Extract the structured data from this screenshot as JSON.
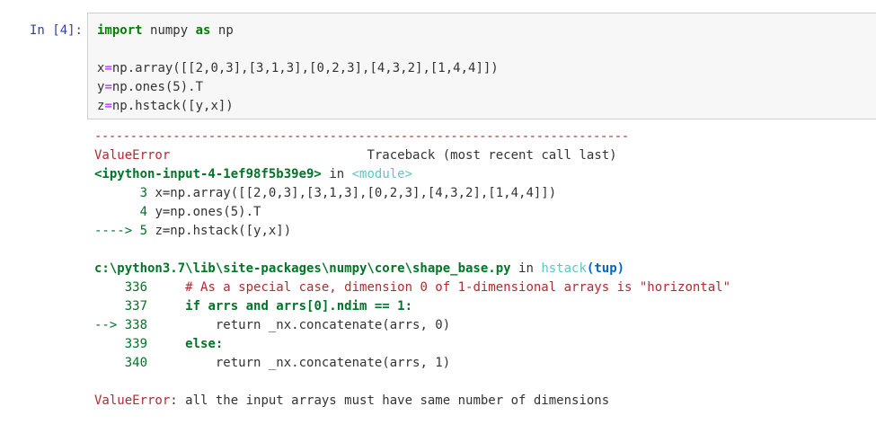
{
  "cell": {
    "prompt": "In [4]:",
    "code": {
      "kw_import": "import",
      "mod": "numpy",
      "kw_as": "as",
      "alias": "np",
      "line2_var": "x",
      "line2_rest": "np.array([[2,0,3],[3,1,3],[0,2,3],[4,3,2],[1,4,4]])",
      "line3_var": "y",
      "line3_rest": "np.ones(5).T",
      "line4_var": "z",
      "line4_rest": "np.hstack([y,x])"
    }
  },
  "output": {
    "separator": "---------------------------------------------------------------------------",
    "error_name": "ValueError",
    "traceback_header": "Traceback (most recent call last)",
    "frame1": {
      "input_name": "<ipython-input-4-1ef98f5b39e9>",
      "in_word": "in",
      "module": "<module>",
      "lines": [
        {
          "prefix": "      3 ",
          "code": "x=np.array([[2,0,3],[3,1,3],[0,2,3],[4,3,2],[1,4,4]])"
        },
        {
          "prefix": "      4 ",
          "code": "y=np.ones(5).T"
        },
        {
          "prefix": "----> 5 ",
          "code": "z=np.hstack([y,x])"
        }
      ]
    },
    "frame2": {
      "path": "c:\\python3.7\\lib\\site-packages\\numpy\\core\\shape_base.py",
      "in_word": "in",
      "func": "hstack",
      "args": "(tup)",
      "lines": [
        {
          "prefix": "    336 ",
          "code": "    # As a special case, dimension 0 of 1-dimensional arrays is \"horizontal\""
        },
        {
          "prefix": "    337 ",
          "code": "    if arrs and arrs[0].ndim == 1:"
        },
        {
          "prefix": "--> 338 ",
          "code": "        return _nx.concatenate(arrs, 0)"
        },
        {
          "prefix": "    339 ",
          "code": "    else:"
        },
        {
          "prefix": "    340 ",
          "code": "        return _nx.concatenate(arrs, 1)"
        }
      ]
    },
    "final": {
      "error_name": "ValueError",
      "message": ": all the input arrays must have same number of dimensions"
    }
  }
}
